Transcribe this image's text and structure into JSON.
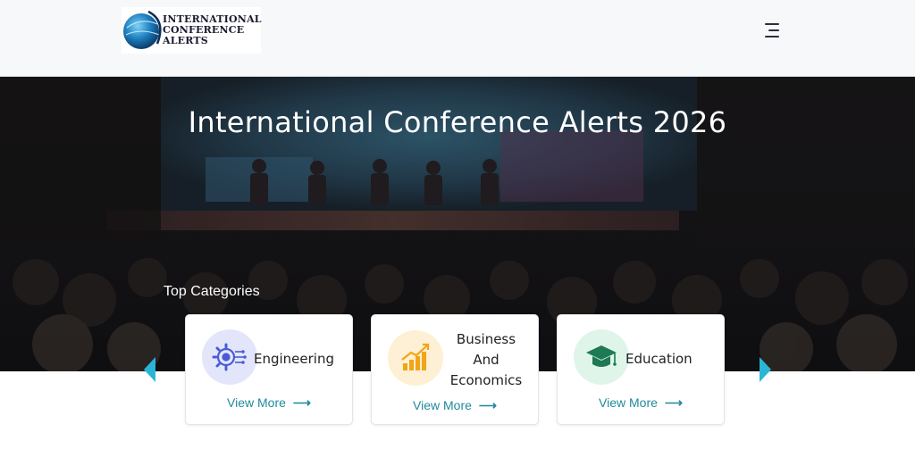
{
  "header": {
    "logo_lines": [
      "INTERNATIONAL",
      "CONFERENCE",
      "ALERTS"
    ],
    "menu_icon": "hamburger-menu-icon"
  },
  "hero": {
    "title": "International Conference Alerts 2026",
    "section_title": "Top Categories"
  },
  "categories": [
    {
      "label": "Engineering",
      "view_more": "View More",
      "icon": "engineering-icon"
    },
    {
      "label_lines": [
        "Business",
        "And",
        "Economics"
      ],
      "view_more": "View More",
      "icon": "chart-growth-icon"
    },
    {
      "label": "Education",
      "view_more": "View More",
      "icon": "graduation-cap-icon"
    }
  ],
  "carousel": {
    "prev_icon": "chevron-left-icon",
    "next_icon": "chevron-right-icon"
  },
  "colors": {
    "accent_teal": "#1f8a9c",
    "arrow_cyan": "#29b6d6",
    "engineering_bg": "#e3e6fb",
    "business_bg": "#fdf0d4",
    "education_bg": "#dff5ea"
  }
}
